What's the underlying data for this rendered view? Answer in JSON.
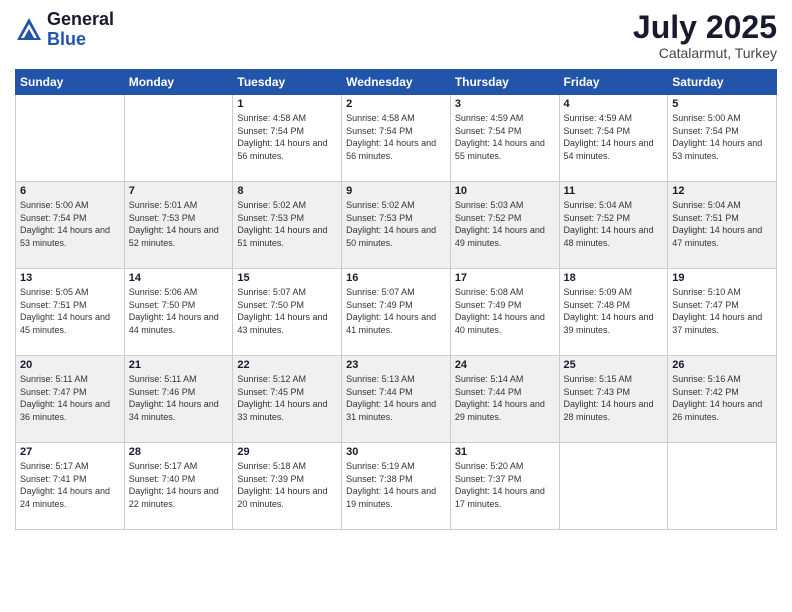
{
  "logo": {
    "general": "General",
    "blue": "Blue"
  },
  "title": {
    "month_year": "July 2025",
    "location": "Catalarmut, Turkey"
  },
  "weekdays": [
    "Sunday",
    "Monday",
    "Tuesday",
    "Wednesday",
    "Thursday",
    "Friday",
    "Saturday"
  ],
  "weeks": [
    [
      {
        "day": "",
        "info": ""
      },
      {
        "day": "",
        "info": ""
      },
      {
        "day": "1",
        "info": "Sunrise: 4:58 AM\nSunset: 7:54 PM\nDaylight: 14 hours and 56 minutes."
      },
      {
        "day": "2",
        "info": "Sunrise: 4:58 AM\nSunset: 7:54 PM\nDaylight: 14 hours and 56 minutes."
      },
      {
        "day": "3",
        "info": "Sunrise: 4:59 AM\nSunset: 7:54 PM\nDaylight: 14 hours and 55 minutes."
      },
      {
        "day": "4",
        "info": "Sunrise: 4:59 AM\nSunset: 7:54 PM\nDaylight: 14 hours and 54 minutes."
      },
      {
        "day": "5",
        "info": "Sunrise: 5:00 AM\nSunset: 7:54 PM\nDaylight: 14 hours and 53 minutes."
      }
    ],
    [
      {
        "day": "6",
        "info": "Sunrise: 5:00 AM\nSunset: 7:54 PM\nDaylight: 14 hours and 53 minutes."
      },
      {
        "day": "7",
        "info": "Sunrise: 5:01 AM\nSunset: 7:53 PM\nDaylight: 14 hours and 52 minutes."
      },
      {
        "day": "8",
        "info": "Sunrise: 5:02 AM\nSunset: 7:53 PM\nDaylight: 14 hours and 51 minutes."
      },
      {
        "day": "9",
        "info": "Sunrise: 5:02 AM\nSunset: 7:53 PM\nDaylight: 14 hours and 50 minutes."
      },
      {
        "day": "10",
        "info": "Sunrise: 5:03 AM\nSunset: 7:52 PM\nDaylight: 14 hours and 49 minutes."
      },
      {
        "day": "11",
        "info": "Sunrise: 5:04 AM\nSunset: 7:52 PM\nDaylight: 14 hours and 48 minutes."
      },
      {
        "day": "12",
        "info": "Sunrise: 5:04 AM\nSunset: 7:51 PM\nDaylight: 14 hours and 47 minutes."
      }
    ],
    [
      {
        "day": "13",
        "info": "Sunrise: 5:05 AM\nSunset: 7:51 PM\nDaylight: 14 hours and 45 minutes."
      },
      {
        "day": "14",
        "info": "Sunrise: 5:06 AM\nSunset: 7:50 PM\nDaylight: 14 hours and 44 minutes."
      },
      {
        "day": "15",
        "info": "Sunrise: 5:07 AM\nSunset: 7:50 PM\nDaylight: 14 hours and 43 minutes."
      },
      {
        "day": "16",
        "info": "Sunrise: 5:07 AM\nSunset: 7:49 PM\nDaylight: 14 hours and 41 minutes."
      },
      {
        "day": "17",
        "info": "Sunrise: 5:08 AM\nSunset: 7:49 PM\nDaylight: 14 hours and 40 minutes."
      },
      {
        "day": "18",
        "info": "Sunrise: 5:09 AM\nSunset: 7:48 PM\nDaylight: 14 hours and 39 minutes."
      },
      {
        "day": "19",
        "info": "Sunrise: 5:10 AM\nSunset: 7:47 PM\nDaylight: 14 hours and 37 minutes."
      }
    ],
    [
      {
        "day": "20",
        "info": "Sunrise: 5:11 AM\nSunset: 7:47 PM\nDaylight: 14 hours and 36 minutes."
      },
      {
        "day": "21",
        "info": "Sunrise: 5:11 AM\nSunset: 7:46 PM\nDaylight: 14 hours and 34 minutes."
      },
      {
        "day": "22",
        "info": "Sunrise: 5:12 AM\nSunset: 7:45 PM\nDaylight: 14 hours and 33 minutes."
      },
      {
        "day": "23",
        "info": "Sunrise: 5:13 AM\nSunset: 7:44 PM\nDaylight: 14 hours and 31 minutes."
      },
      {
        "day": "24",
        "info": "Sunrise: 5:14 AM\nSunset: 7:44 PM\nDaylight: 14 hours and 29 minutes."
      },
      {
        "day": "25",
        "info": "Sunrise: 5:15 AM\nSunset: 7:43 PM\nDaylight: 14 hours and 28 minutes."
      },
      {
        "day": "26",
        "info": "Sunrise: 5:16 AM\nSunset: 7:42 PM\nDaylight: 14 hours and 26 minutes."
      }
    ],
    [
      {
        "day": "27",
        "info": "Sunrise: 5:17 AM\nSunset: 7:41 PM\nDaylight: 14 hours and 24 minutes."
      },
      {
        "day": "28",
        "info": "Sunrise: 5:17 AM\nSunset: 7:40 PM\nDaylight: 14 hours and 22 minutes."
      },
      {
        "day": "29",
        "info": "Sunrise: 5:18 AM\nSunset: 7:39 PM\nDaylight: 14 hours and 20 minutes."
      },
      {
        "day": "30",
        "info": "Sunrise: 5:19 AM\nSunset: 7:38 PM\nDaylight: 14 hours and 19 minutes."
      },
      {
        "day": "31",
        "info": "Sunrise: 5:20 AM\nSunset: 7:37 PM\nDaylight: 14 hours and 17 minutes."
      },
      {
        "day": "",
        "info": ""
      },
      {
        "day": "",
        "info": ""
      }
    ]
  ]
}
